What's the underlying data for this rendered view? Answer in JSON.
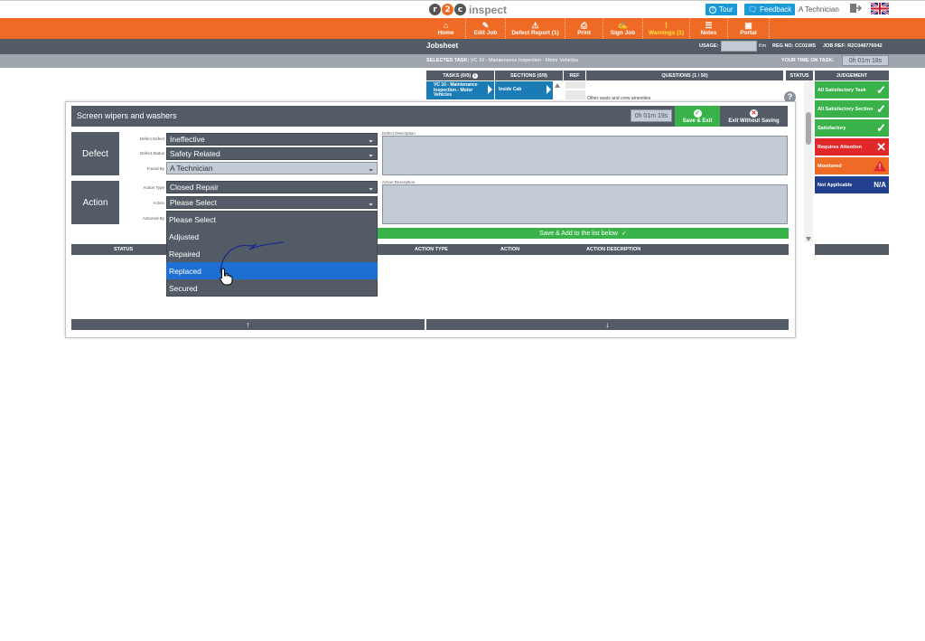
{
  "header": {
    "logo_text": "inspect",
    "logo_letters": [
      "r",
      "2",
      "c"
    ],
    "tour_label": "Tour",
    "feedback_label": "Feedback",
    "user_name": "A Technician"
  },
  "nav": {
    "items": [
      {
        "label": "Home",
        "icon": "home-icon"
      },
      {
        "label": "Edit Job",
        "icon": "edit-icon"
      },
      {
        "label": "Defect Report (1)",
        "icon": "warning-icon"
      },
      {
        "label": "Print",
        "icon": "printer-icon"
      },
      {
        "label": "Sign Job",
        "icon": "pen-icon"
      },
      {
        "label": "Warnings (1)",
        "icon": "exclamation-icon"
      },
      {
        "label": "Notes",
        "icon": "notes-icon"
      },
      {
        "label": "Portal",
        "icon": "portal-icon"
      }
    ]
  },
  "jobsheet": {
    "title": "Jobsheet",
    "usage_label": "USAGE:",
    "usage_unit": "Km",
    "reg_no": "REG NO: CC01WS",
    "job_ref": "JOB REF: R2C048776042"
  },
  "task_bar": {
    "selected_task_label": "SELECTED TASK:",
    "selected_task": "VC 10 - Maintenance Inspection - Motor Vehicles",
    "your_time_label": "YOUR TIME ON TASK:",
    "your_time_value": "0h 01m 18s"
  },
  "columns": {
    "tasks": "TASKS (0/0)",
    "sections": "SECTIONS (0/9)",
    "ref": "REF",
    "questions": "QUESTIONS (1 / 50)",
    "status": "STATUS",
    "judgement": "JUDGEMENT"
  },
  "task_tile": "VC 10 - Maintenance Inspection - Motor Vehicles",
  "section_tile": "Inside Cab",
  "question_text": "Other seats and crew amenities",
  "judgements": [
    {
      "label": "All Satisfactory Task",
      "symbol": "✓",
      "color": "#39b24a"
    },
    {
      "label": "All Satisfactory Section",
      "symbol": "✓",
      "color": "#39b24a"
    },
    {
      "label": "Satisfactory",
      "symbol": "✓",
      "color": "#39b24a"
    },
    {
      "label": "Requires Attention",
      "symbol": "✕",
      "color": "#e0272a"
    },
    {
      "label": "Monitored",
      "symbol": "!",
      "color": "#ef6a25"
    },
    {
      "label": "Not Applicable",
      "symbol": "N/A",
      "color": "#23408e"
    }
  ],
  "modal": {
    "title": "Screen wipers and washers",
    "timer": "0h 01m 19s",
    "save_exit": "Save & Exit",
    "exit_without_saving": "Exit Without Saving",
    "defect": {
      "label": "Defect",
      "defect_label": "Defect Defect",
      "defect_value": "Ineffective",
      "status_label": "Defect Status",
      "status_value": "Safety Related",
      "found_by_label": "Found By",
      "found_by_value": "A Technician",
      "description_label": "Defect Description"
    },
    "action": {
      "label": "Action",
      "type_label": "Action Type",
      "type_value": "Closed Repair",
      "action_label": "Action",
      "action_value": "Please Select",
      "actioned_by_label": "Actioned By",
      "description_label": "Action Description"
    },
    "dropdown_options": [
      "Please Select",
      "Adjusted",
      "Repaired",
      "Replaced",
      "Secured"
    ],
    "save_add": "Save & Add to the list below",
    "table_headers": [
      "STATUS",
      "ACTION TYPE",
      "ACTION",
      "ACTION DESCRIPTION"
    ]
  }
}
